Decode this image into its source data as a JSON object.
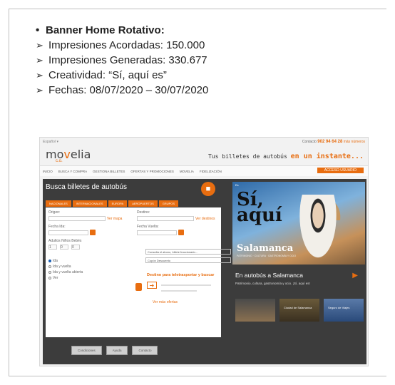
{
  "slide": {
    "heading": "Banner Home Rotativo:",
    "bullet_glyph": "•",
    "arrow_glyph": "➢",
    "items": [
      "Impresiones Acordadas: 150.000",
      "Impresiones Generadas: 330.677",
      "Creatividad: “Sí, aquí es”",
      "Fechas: 08/07/2020 – 30/07/2020"
    ]
  },
  "site": {
    "topbar_left": "Español ▾",
    "phone_label": "Contacto",
    "phone": "902 94 64 28",
    "phone_link": "más números",
    "logo_main": "mo",
    "logo_v": "v",
    "logo_rest": "elia",
    "logo_sub": "c.o.",
    "tagline": "Tus billetes de autobús",
    "tagline_highlight": "en un instante...",
    "nav": [
      "INICIO",
      "BUSCA Y COMPRA",
      "GESTIONA BILLETES",
      "OFERTAS Y PROMOCIONES",
      "MOVELIA",
      "FIDELIZACIÓN"
    ],
    "nav_button": "ACCESO USUARIO",
    "search_title": "Busca billetes de autobús",
    "tabs": [
      "NACIONALES",
      "INTERNACIONALES",
      "EUROPA",
      "AEROPUERTOS",
      "GRUPOS"
    ],
    "origin_label": "Origen:",
    "dest_label": "Destino:",
    "see_map": "Ver mapa",
    "see_dest": "Ver destinos",
    "date_out_label": "Fecha Ida:",
    "date_back_label": "Fecha Vuelta:",
    "passengers_label": "Adultos  Niños  Bebés",
    "adults_val": "1",
    "children_val": "0",
    "babies_val": "0",
    "radio_one": "Ida",
    "radio_two": "Ida y vuelta",
    "radio_three": "Ida y vuelta abierta",
    "open_label": "Ver",
    "info_one": "Consulta el abono, billete fraccionado...",
    "info_two": "Cupón Descuento",
    "cta_text": "Destino para teletrasportar y buscar",
    "more_link": "Ver más ofertas",
    "bottom_buttons": [
      "Condiciones",
      "Ayuda",
      "Contacto"
    ],
    "banner_si": "Sí,",
    "banner_aqui": "aquí",
    "banner_city": "Salamanca",
    "banner_sub": "PATRIMONIO · CULTURA · GASTRONOMÍA Y OCIO",
    "banner_corner": "Es",
    "promo_title": "En autobús a Salamanca",
    "promo_sub": "Patrimonio, cultura, gastronomía y ocio. ¡Sí, aquí es!",
    "thumb_labels": [
      "",
      "Ciudad de Salamanca",
      "Seguro de Viajes"
    ]
  }
}
